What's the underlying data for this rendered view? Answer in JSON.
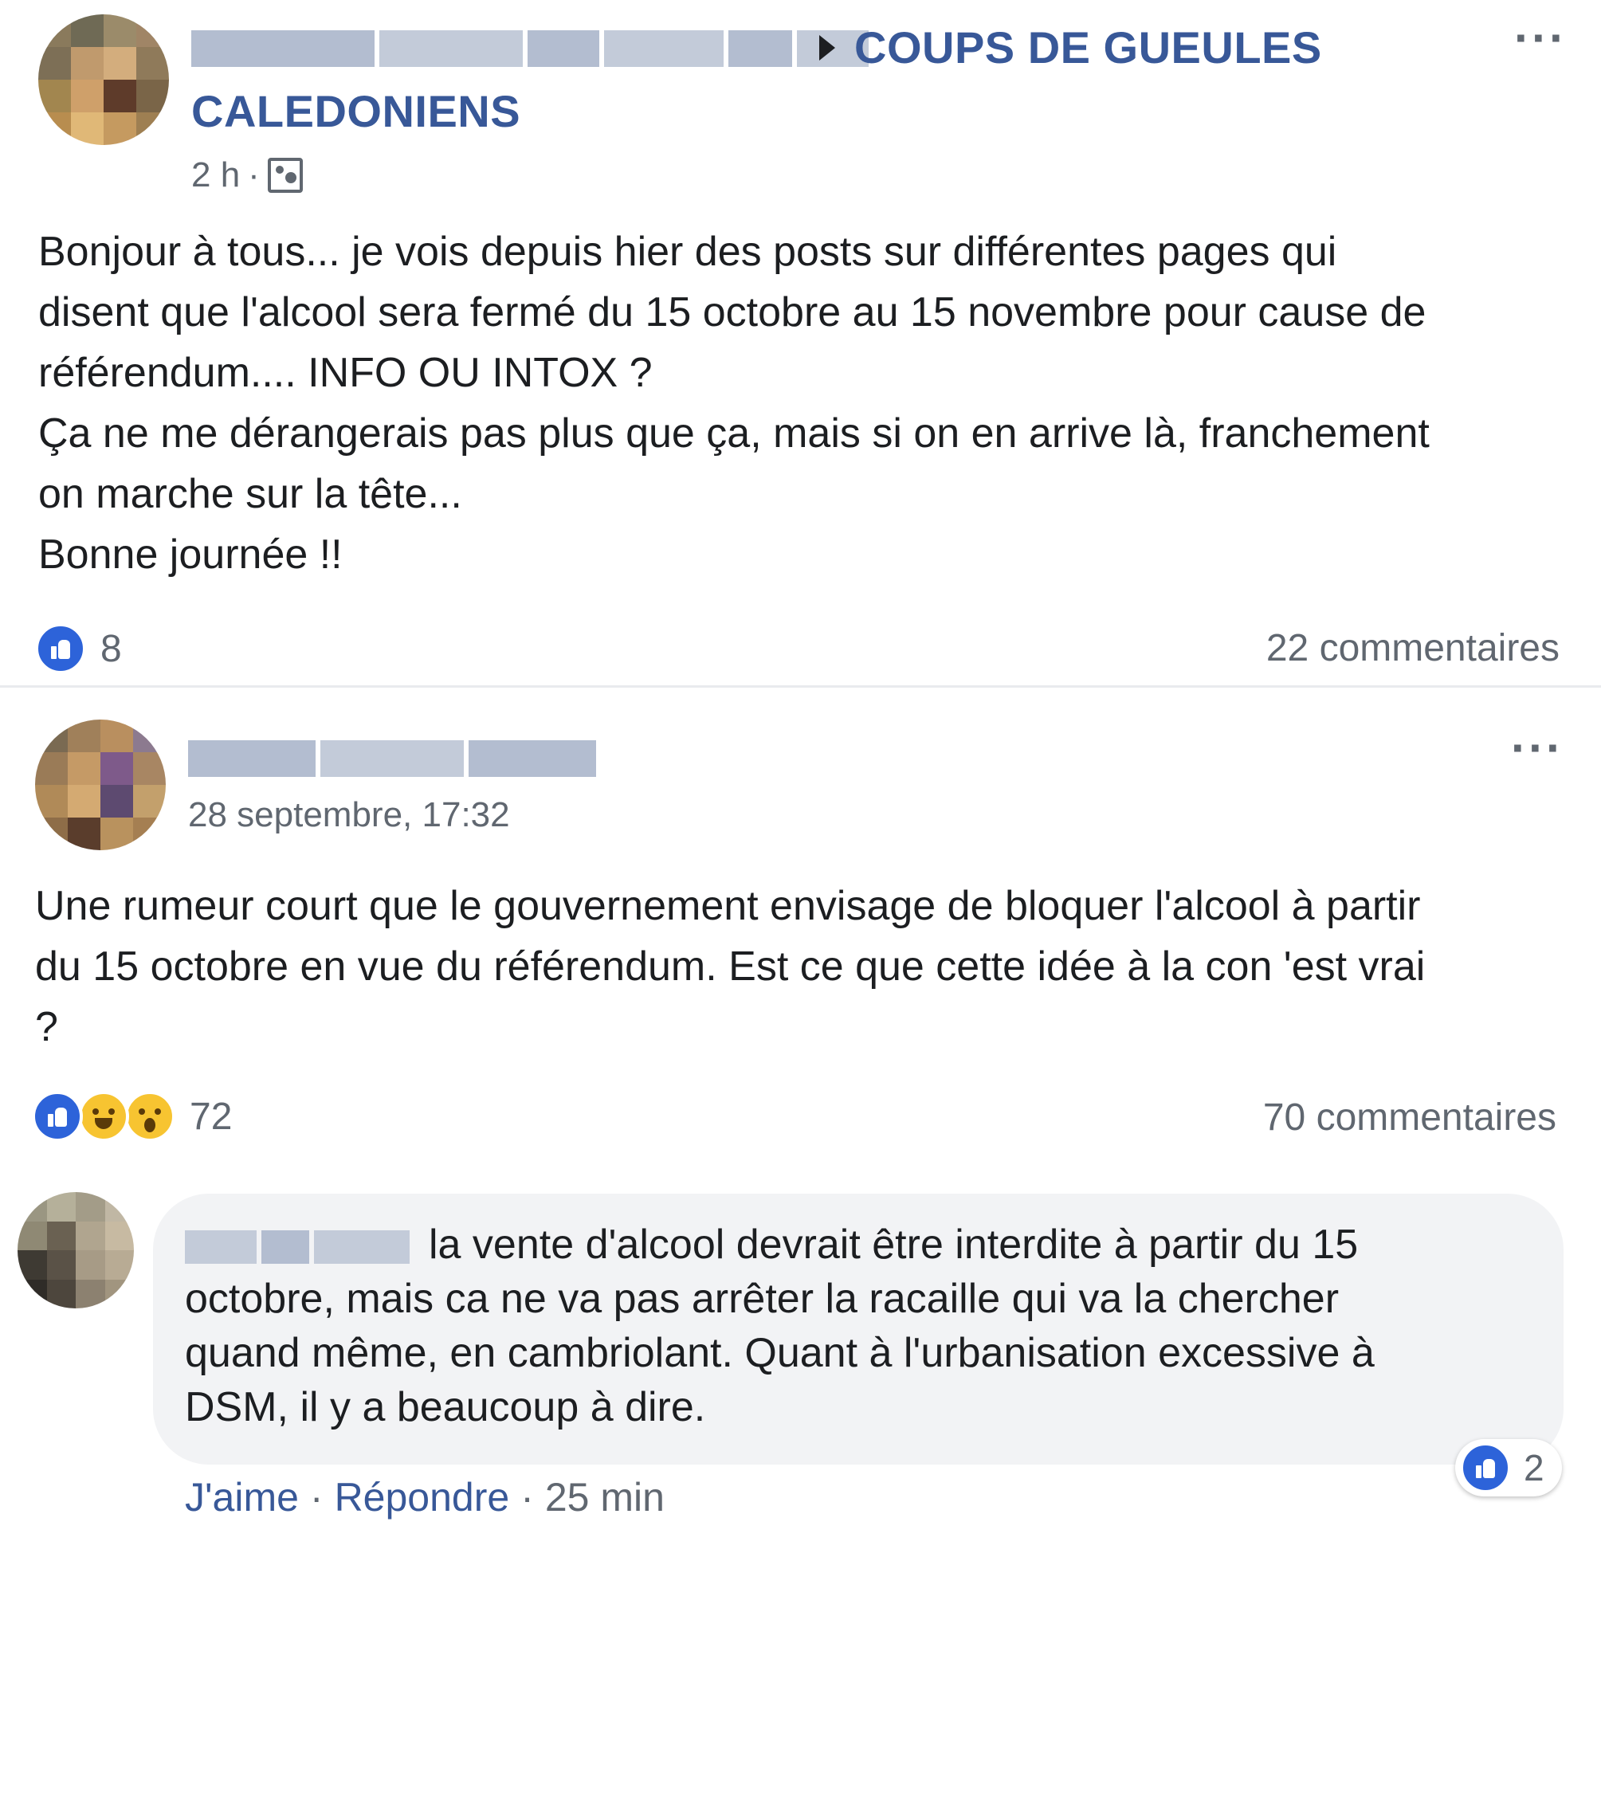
{
  "post1": {
    "group_name": "COUPS DE GUEULES CALEDONIENS",
    "group_name_line1": "COUPS DE GUEULES",
    "group_name_line2": "CALEDONIENS",
    "time": "2 h",
    "separator": "·",
    "lines": [
      "Bonjour à tous... je vois depuis hier des posts sur différentes pages qui",
      "disent que l'alcool sera fermé du 15 octobre au 15 novembre pour cause de",
      "référendum.... INFO OU INTOX ?",
      "Ça ne me dérangerais pas plus que ça, mais si on en arrive là, franchement",
      "on marche sur la tête...",
      "Bonne journée !!"
    ],
    "reactions": [
      "like"
    ],
    "reaction_count": "8",
    "comments": "22 commentaires"
  },
  "post2": {
    "date": "28 septembre, 17:32",
    "lines": [
      "Une rumeur court que le gouvernement envisage de bloquer l'alcool à partir",
      "du 15 octobre en vue du référendum. Est ce que cette idée à la con 'est vrai",
      "?"
    ],
    "reactions": [
      "like",
      "haha",
      "wow"
    ],
    "reaction_count": "72",
    "comments": "70 commentaires"
  },
  "comment": {
    "lines": [
      "la vente d'alcool devrait être interdite à partir du 15",
      "octobre, mais ca ne va pas arrêter la racaille qui va la chercher",
      "quand même, en cambriolant. Quant à l'urbanisation excessive à",
      "DSM, il y a beaucoup à dire."
    ],
    "like_label": "J'aime",
    "reply_label": "Répondre",
    "time": "25 min",
    "separator": "·",
    "reaction_count": "2"
  },
  "icons": {
    "more": "more-options-icon",
    "audience": "audience-icon",
    "like": "like-reaction-icon",
    "haha": "haha-reaction-icon",
    "wow": "wow-reaction-icon"
  },
  "colors": {
    "link": "#385898",
    "meta": "#606770",
    "like": "#2d63d9",
    "bubble": "#f2f3f5"
  }
}
